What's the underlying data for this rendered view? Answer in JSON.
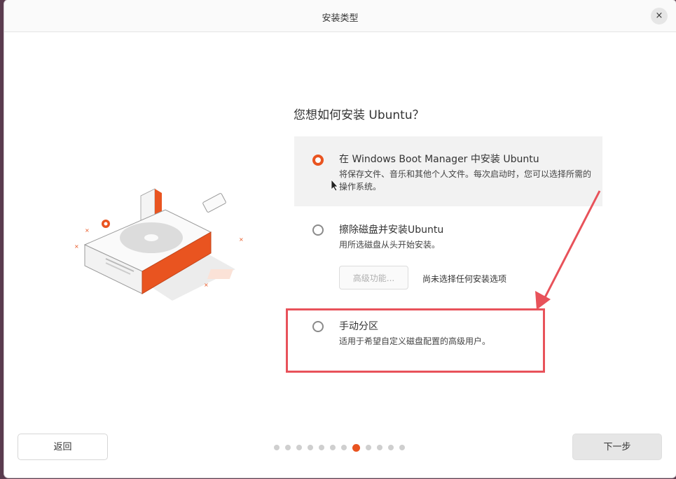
{
  "window": {
    "title": "安装类型",
    "close_label": "×"
  },
  "main": {
    "question": "您想如何安装 Ubuntu？",
    "options": [
      {
        "title": "在 Windows Boot Manager 中安装 Ubuntu",
        "description": "将保存文件、音乐和其他个人文件。每次启动时，您可以选择所需的操作系统。",
        "selected": true
      },
      {
        "title": "擦除磁盘并安装Ubuntu",
        "description": "用所选磁盘从头开始安装。",
        "selected": false
      },
      {
        "title": "手动分区",
        "description": "适用于希望自定义磁盘配置的高级用户。",
        "selected": false
      }
    ],
    "advanced_button": "高级功能...",
    "advanced_status": "尚未选择任何安装选项"
  },
  "footer": {
    "back_label": "返回",
    "next_label": "下一步",
    "page_dots": 12,
    "current_dot_index": 7
  },
  "colors": {
    "accent": "#e95420",
    "annotation": "#e8525a"
  }
}
